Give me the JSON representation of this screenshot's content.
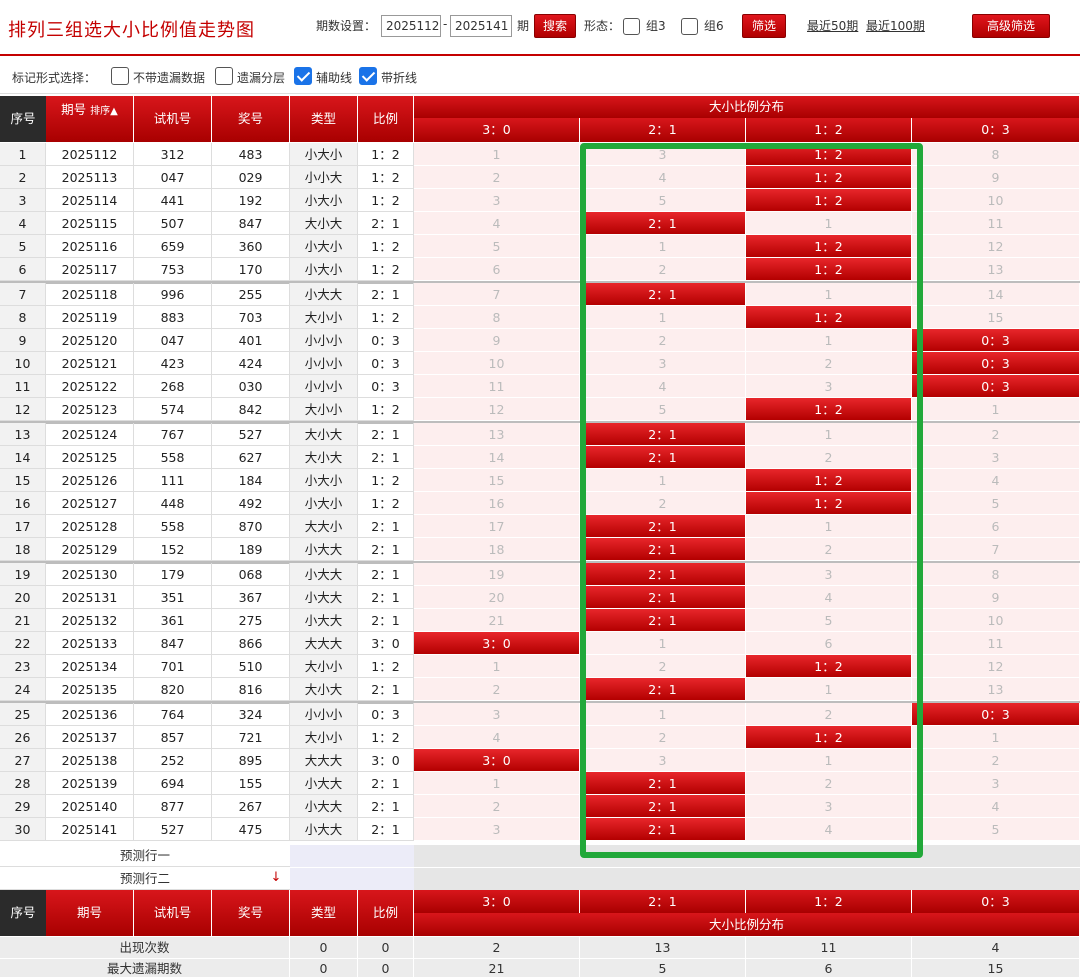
{
  "header": {
    "title": "排列三组选大小比例值走势图",
    "period_label": "期数设置：",
    "period_from": "2025112",
    "period_dash": "-",
    "period_to": "2025141",
    "period_unit": "期",
    "search_label": "搜索",
    "form_label": "形态：",
    "group3_label": "组3",
    "group6_label": "组6",
    "filter_label": "筛选",
    "recent50": "最近50期",
    "recent100": "最近100期",
    "advanced_label": "高级筛选"
  },
  "options": {
    "label": "标记形式选择：",
    "items": [
      {
        "label": "不带遗漏数据",
        "checked": false
      },
      {
        "label": "遗漏分层",
        "checked": false
      },
      {
        "label": "辅助线",
        "checked": true
      },
      {
        "label": "带折线",
        "checked": true
      }
    ]
  },
  "table": {
    "headers": {
      "seq": "序号",
      "issue": "期号",
      "sort_label": "排序",
      "test": "试机号",
      "draw": "奖号",
      "type": "类型",
      "ratio": "比例",
      "dist_title": "大小比例分布",
      "dist_cols": [
        "3：0",
        "2：1",
        "1：2",
        "0：3"
      ]
    },
    "rows": [
      {
        "seq": "1",
        "issue": "2025112",
        "test": "312",
        "draw": "483",
        "type": "小大小",
        "ratio": "1：2",
        "dist": [
          "1",
          "3",
          "1：2",
          "8"
        ],
        "hit": 2
      },
      {
        "seq": "2",
        "issue": "2025113",
        "test": "047",
        "draw": "029",
        "type": "小小大",
        "ratio": "1：2",
        "dist": [
          "2",
          "4",
          "1：2",
          "9"
        ],
        "hit": 2
      },
      {
        "seq": "3",
        "issue": "2025114",
        "test": "441",
        "draw": "192",
        "type": "小大小",
        "ratio": "1：2",
        "dist": [
          "3",
          "5",
          "1：2",
          "10"
        ],
        "hit": 2
      },
      {
        "seq": "4",
        "issue": "2025115",
        "test": "507",
        "draw": "847",
        "type": "大小大",
        "ratio": "2：1",
        "dist": [
          "4",
          "2：1",
          "1",
          "11"
        ],
        "hit": 1
      },
      {
        "seq": "5",
        "issue": "2025116",
        "test": "659",
        "draw": "360",
        "type": "小大小",
        "ratio": "1：2",
        "dist": [
          "5",
          "1",
          "1：2",
          "12"
        ],
        "hit": 2
      },
      {
        "seq": "6",
        "issue": "2025117",
        "test": "753",
        "draw": "170",
        "type": "小大小",
        "ratio": "1：2",
        "dist": [
          "6",
          "2",
          "1：2",
          "13"
        ],
        "hit": 2
      },
      {
        "seq": "7",
        "issue": "2025118",
        "test": "996",
        "draw": "255",
        "type": "小大大",
        "ratio": "2：1",
        "dist": [
          "7",
          "2：1",
          "1",
          "14"
        ],
        "hit": 1
      },
      {
        "seq": "8",
        "issue": "2025119",
        "test": "883",
        "draw": "703",
        "type": "大小小",
        "ratio": "1：2",
        "dist": [
          "8",
          "1",
          "1：2",
          "15"
        ],
        "hit": 2
      },
      {
        "seq": "9",
        "issue": "2025120",
        "test": "047",
        "draw": "401",
        "type": "小小小",
        "ratio": "0：3",
        "dist": [
          "9",
          "2",
          "1",
          "0：3"
        ],
        "hit": 3
      },
      {
        "seq": "10",
        "issue": "2025121",
        "test": "423",
        "draw": "424",
        "type": "小小小",
        "ratio": "0：3",
        "dist": [
          "10",
          "3",
          "2",
          "0：3"
        ],
        "hit": 3
      },
      {
        "seq": "11",
        "issue": "2025122",
        "test": "268",
        "draw": "030",
        "type": "小小小",
        "ratio": "0：3",
        "dist": [
          "11",
          "4",
          "3",
          "0：3"
        ],
        "hit": 3
      },
      {
        "seq": "12",
        "issue": "2025123",
        "test": "574",
        "draw": "842",
        "type": "大小小",
        "ratio": "1：2",
        "dist": [
          "12",
          "5",
          "1：2",
          "1"
        ],
        "hit": 2
      },
      {
        "seq": "13",
        "issue": "2025124",
        "test": "767",
        "draw": "527",
        "type": "大小大",
        "ratio": "2：1",
        "dist": [
          "13",
          "2：1",
          "1",
          "2"
        ],
        "hit": 1
      },
      {
        "seq": "14",
        "issue": "2025125",
        "test": "558",
        "draw": "627",
        "type": "大小大",
        "ratio": "2：1",
        "dist": [
          "14",
          "2：1",
          "2",
          "3"
        ],
        "hit": 1
      },
      {
        "seq": "15",
        "issue": "2025126",
        "test": "111",
        "draw": "184",
        "type": "小大小",
        "ratio": "1：2",
        "dist": [
          "15",
          "1",
          "1：2",
          "4"
        ],
        "hit": 2
      },
      {
        "seq": "16",
        "issue": "2025127",
        "test": "448",
        "draw": "492",
        "type": "小大小",
        "ratio": "1：2",
        "dist": [
          "16",
          "2",
          "1：2",
          "5"
        ],
        "hit": 2
      },
      {
        "seq": "17",
        "issue": "2025128",
        "test": "558",
        "draw": "870",
        "type": "大大小",
        "ratio": "2：1",
        "dist": [
          "17",
          "2：1",
          "1",
          "6"
        ],
        "hit": 1
      },
      {
        "seq": "18",
        "issue": "2025129",
        "test": "152",
        "draw": "189",
        "type": "小大大",
        "ratio": "2：1",
        "dist": [
          "18",
          "2：1",
          "2",
          "7"
        ],
        "hit": 1
      },
      {
        "seq": "19",
        "issue": "2025130",
        "test": "179",
        "draw": "068",
        "type": "小大大",
        "ratio": "2：1",
        "dist": [
          "19",
          "2：1",
          "3",
          "8"
        ],
        "hit": 1
      },
      {
        "seq": "20",
        "issue": "2025131",
        "test": "351",
        "draw": "367",
        "type": "小大大",
        "ratio": "2：1",
        "dist": [
          "20",
          "2：1",
          "4",
          "9"
        ],
        "hit": 1
      },
      {
        "seq": "21",
        "issue": "2025132",
        "test": "361",
        "draw": "275",
        "type": "小大大",
        "ratio": "2：1",
        "dist": [
          "21",
          "2：1",
          "5",
          "10"
        ],
        "hit": 1
      },
      {
        "seq": "22",
        "issue": "2025133",
        "test": "847",
        "draw": "866",
        "type": "大大大",
        "ratio": "3：0",
        "dist": [
          "3：0",
          "1",
          "6",
          "11"
        ],
        "hit": 0
      },
      {
        "seq": "23",
        "issue": "2025134",
        "test": "701",
        "draw": "510",
        "type": "大小小",
        "ratio": "1：2",
        "dist": [
          "1",
          "2",
          "1：2",
          "12"
        ],
        "hit": 2
      },
      {
        "seq": "24",
        "issue": "2025135",
        "test": "820",
        "draw": "816",
        "type": "大小大",
        "ratio": "2：1",
        "dist": [
          "2",
          "2：1",
          "1",
          "13"
        ],
        "hit": 1
      },
      {
        "seq": "25",
        "issue": "2025136",
        "test": "764",
        "draw": "324",
        "type": "小小小",
        "ratio": "0：3",
        "dist": [
          "3",
          "1",
          "2",
          "0：3"
        ],
        "hit": 3
      },
      {
        "seq": "26",
        "issue": "2025137",
        "test": "857",
        "draw": "721",
        "type": "大小小",
        "ratio": "1：2",
        "dist": [
          "4",
          "2",
          "1：2",
          "1"
        ],
        "hit": 2
      },
      {
        "seq": "27",
        "issue": "2025138",
        "test": "252",
        "draw": "895",
        "type": "大大大",
        "ratio": "3：0",
        "dist": [
          "3：0",
          "3",
          "1",
          "2"
        ],
        "hit": 0
      },
      {
        "seq": "28",
        "issue": "2025139",
        "test": "694",
        "draw": "155",
        "type": "小大大",
        "ratio": "2：1",
        "dist": [
          "1",
          "2：1",
          "2",
          "3"
        ],
        "hit": 1
      },
      {
        "seq": "29",
        "issue": "2025140",
        "test": "877",
        "draw": "267",
        "type": "小大大",
        "ratio": "2：1",
        "dist": [
          "2",
          "2：1",
          "3",
          "4"
        ],
        "hit": 1
      },
      {
        "seq": "30",
        "issue": "2025141",
        "test": "527",
        "draw": "475",
        "type": "小大大",
        "ratio": "2：1",
        "dist": [
          "3",
          "2：1",
          "4",
          "5"
        ],
        "hit": 1
      }
    ],
    "predict": [
      "预测行一",
      "预测行二"
    ],
    "footer": {
      "occurrences_label": "出现次数",
      "occurrences": {
        "type": "0",
        "ratio": "0",
        "dist": [
          "2",
          "13",
          "11",
          "4"
        ]
      },
      "max_miss_label": "最大遗漏期数",
      "max_miss": {
        "type": "0",
        "ratio": "0",
        "dist": [
          "21",
          "5",
          "6",
          "15"
        ]
      }
    }
  },
  "colors": {
    "accent": "#c40000",
    "highlight": "#22a83a",
    "checkbox": "#1a73e8"
  }
}
